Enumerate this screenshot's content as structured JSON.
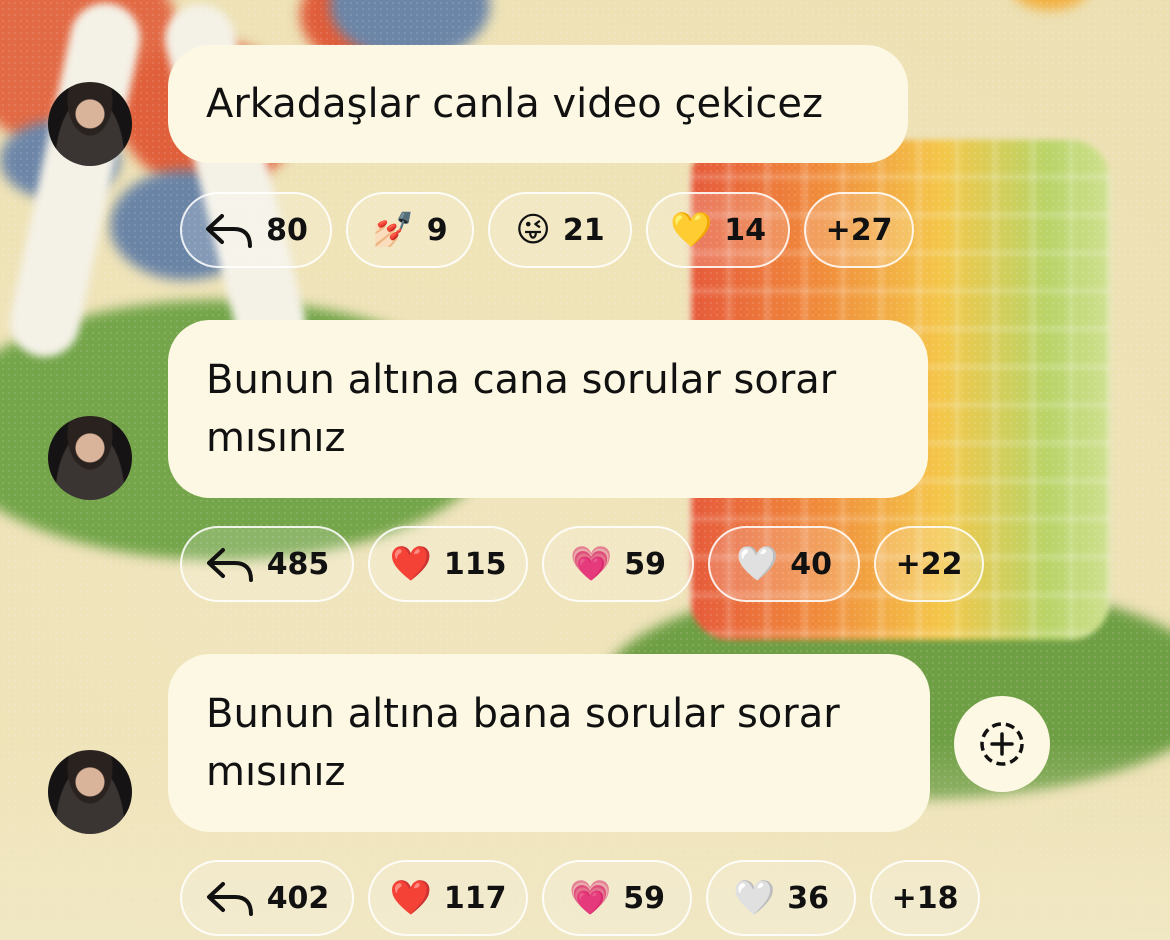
{
  "messages": [
    {
      "text": "Arkadaşlar canla video çekicez",
      "reactions": [
        {
          "icon": "reply-icon",
          "count": "80"
        },
        {
          "icon": "nail-polish-icon",
          "emoji": "💅🏻",
          "count": "9"
        },
        {
          "icon": "winking-tongue-icon",
          "emoji": "😜",
          "count": "21"
        },
        {
          "icon": "yellow-heart-icon",
          "emoji": "💛",
          "count": "14"
        },
        {
          "label": "+27"
        }
      ]
    },
    {
      "text_line1": "Bunun altına cana sorular sorar",
      "text_line2": "mısınız",
      "reactions": [
        {
          "icon": "reply-icon",
          "count": "485"
        },
        {
          "icon": "red-heart-icon",
          "emoji": "❤️",
          "count": "115"
        },
        {
          "icon": "sparkling-heart-icon",
          "emoji": "💗",
          "count": "59"
        },
        {
          "icon": "white-heart-icon",
          "emoji": "🤍",
          "count": "40"
        },
        {
          "label": "+22"
        }
      ]
    },
    {
      "text_line1": "Bunun altına bana sorular sorar",
      "text_line2": "mısınız",
      "reactions": [
        {
          "icon": "reply-icon",
          "count": "402"
        },
        {
          "icon": "red-heart-icon",
          "emoji": "❤️",
          "count": "117"
        },
        {
          "icon": "sparkling-heart-icon",
          "emoji": "💗",
          "count": "59"
        },
        {
          "icon": "white-heart-icon",
          "emoji": "🤍",
          "count": "36"
        },
        {
          "label": "+18"
        }
      ]
    }
  ],
  "add_reaction_icon": "add-reaction-icon"
}
